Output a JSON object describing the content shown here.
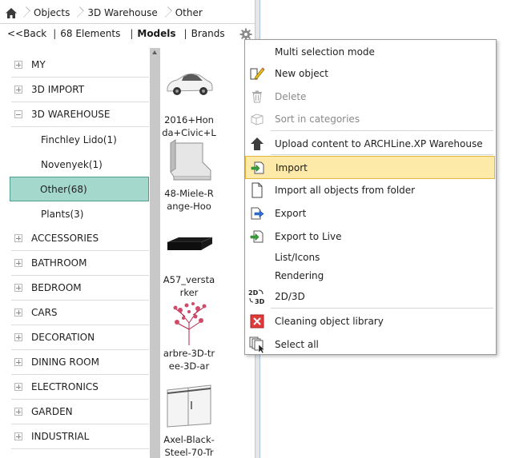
{
  "breadcrumb": {
    "items": [
      "Objects",
      "3D Warehouse",
      "Other"
    ]
  },
  "toolbar": {
    "back": "<<Back",
    "elements": "68 Elements",
    "models": "Models",
    "brands": "Brands",
    "sep": "|"
  },
  "tree": [
    {
      "label": "MY",
      "type": "root"
    },
    {
      "label": "3D IMPORT",
      "type": "root"
    },
    {
      "label": "3D WAREHOUSE",
      "type": "expanded"
    },
    {
      "label": "Finchley Lido(1)",
      "type": "child"
    },
    {
      "label": "Novenyek(1)",
      "type": "child"
    },
    {
      "label": "Other(68)",
      "type": "selected"
    },
    {
      "label": "Plants(3)",
      "type": "child"
    },
    {
      "label": "ACCESSORIES",
      "type": "root"
    },
    {
      "label": "BATHROOM",
      "type": "root"
    },
    {
      "label": "BEDROOM",
      "type": "root"
    },
    {
      "label": "CARS",
      "type": "root"
    },
    {
      "label": "DECORATION",
      "type": "root"
    },
    {
      "label": "DINING ROOM",
      "type": "root"
    },
    {
      "label": "ELECTRONICS",
      "type": "root"
    },
    {
      "label": "GARDEN",
      "type": "root"
    },
    {
      "label": "INDUSTRIAL",
      "type": "root"
    }
  ],
  "thumbnails": [
    {
      "label": "2016+Honda+Civic+L",
      "icon": "car"
    },
    {
      "label": "48-Miele-Range-Hoo",
      "icon": "range-hood"
    },
    {
      "label": "A57_verstarker",
      "icon": "amplifier"
    },
    {
      "label": "arbre-3D-tree-3D-ar",
      "icon": "tree"
    },
    {
      "label": "Axel-Black-Steel-70-Tr",
      "icon": "sliding-door"
    }
  ],
  "menu": {
    "items": [
      {
        "label": "Multi selection mode",
        "icon": "none",
        "disabled": false
      },
      {
        "label": "New object",
        "icon": "new-object-pencil-icon",
        "disabled": false
      },
      {
        "label": "Delete",
        "icon": "trash-icon",
        "disabled": true
      },
      {
        "label": "Sort in categories",
        "icon": "sort-categories-icon",
        "disabled": true
      },
      {
        "label": "Upload content to ARCHLine.XP Warehouse",
        "icon": "upload-house-icon",
        "disabled": false
      },
      {
        "label": "Import",
        "icon": "import-icon",
        "disabled": false,
        "highlight": true
      },
      {
        "label": "Import all objects from folder",
        "icon": "document-icon",
        "disabled": false
      },
      {
        "label": "Export",
        "icon": "export-icon",
        "disabled": false
      },
      {
        "label": "Export to Live",
        "icon": "export-live-icon",
        "disabled": false
      },
      {
        "label": "List/Icons",
        "icon": "none",
        "disabled": false
      },
      {
        "label": "Rendering",
        "icon": "none",
        "disabled": false
      },
      {
        "label": "2D/3D",
        "icon": "2d-3d-icon",
        "disabled": false
      },
      {
        "label": "Cleaning object library",
        "icon": "red-x-icon",
        "disabled": false
      },
      {
        "label": "Select all",
        "icon": "select-all-icon",
        "disabled": false
      }
    ],
    "icon_2d": "2D",
    "icon_3d": "3D"
  },
  "colors": {
    "selected_bg": "#a5d8cd",
    "highlight_bg": "#fde9a8",
    "highlight_border": "#e3b53e"
  }
}
